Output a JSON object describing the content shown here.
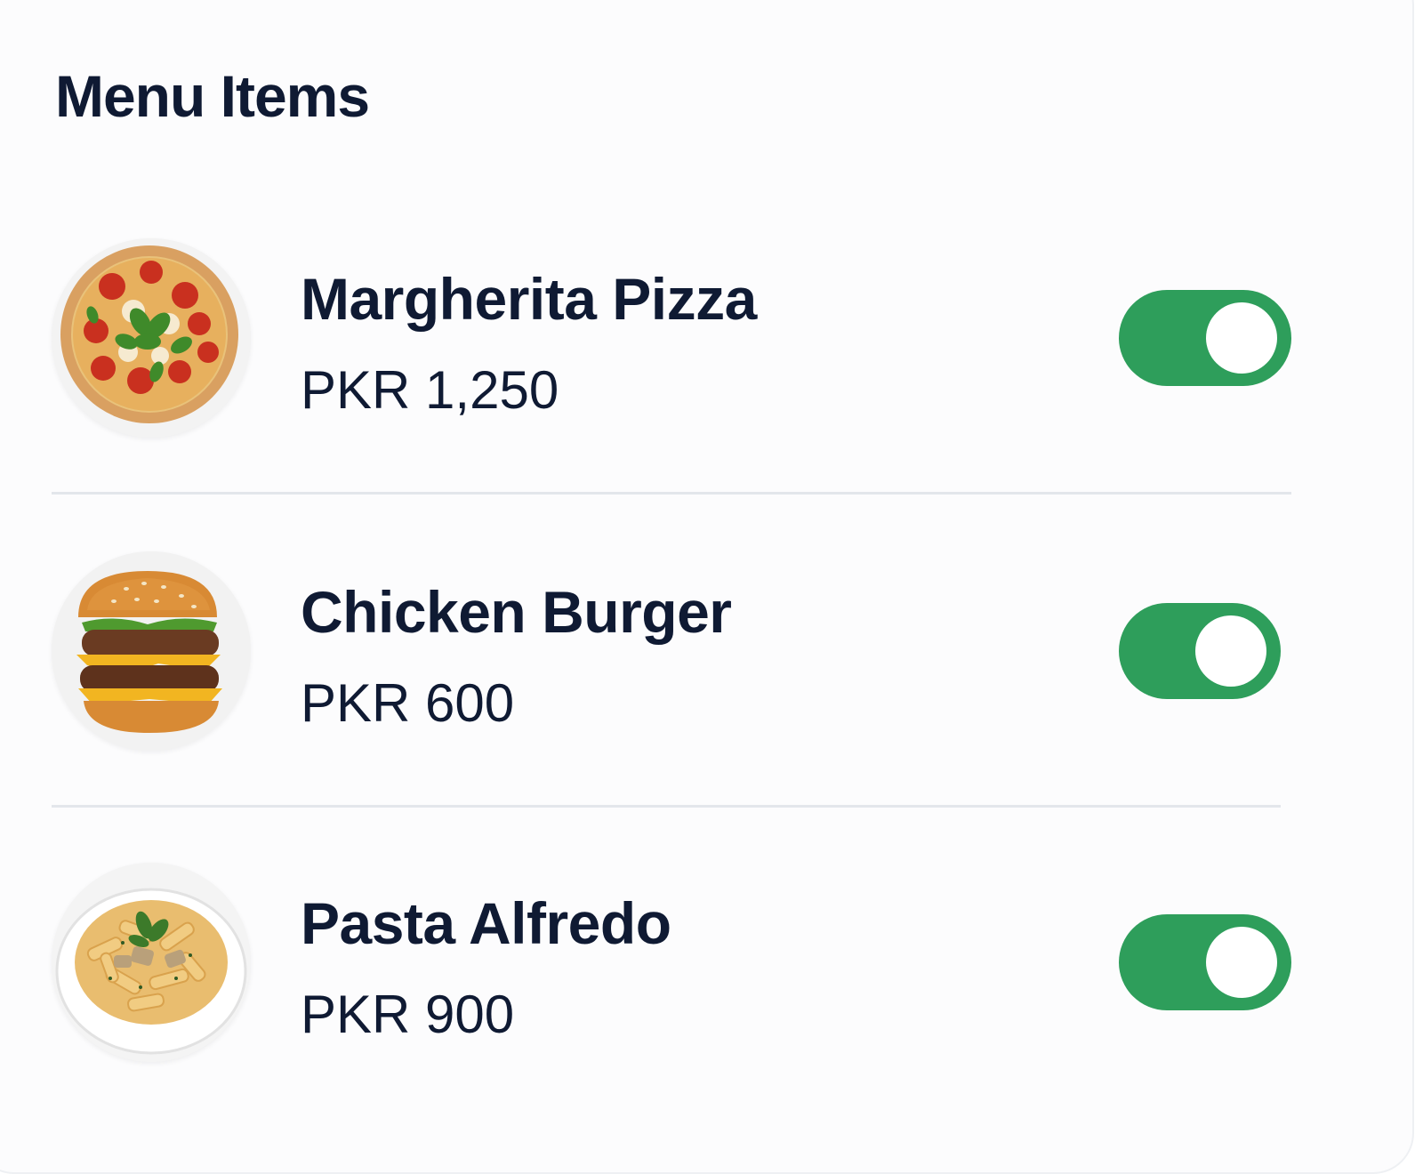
{
  "header": {
    "title": "Menu Items"
  },
  "items": [
    {
      "name": "Margherita Pizza",
      "price": "PKR 1,250",
      "available": true,
      "image": "pizza"
    },
    {
      "name": "Chicken Burger",
      "price": "PKR 600",
      "available": true,
      "image": "burger"
    },
    {
      "name": "Pasta Alfredo",
      "price": "PKR 900",
      "available": true,
      "image": "pasta"
    }
  ],
  "colors": {
    "toggle_on": "#2e9e5b",
    "text": "#0f1a33",
    "divider": "#e3e6eb"
  }
}
